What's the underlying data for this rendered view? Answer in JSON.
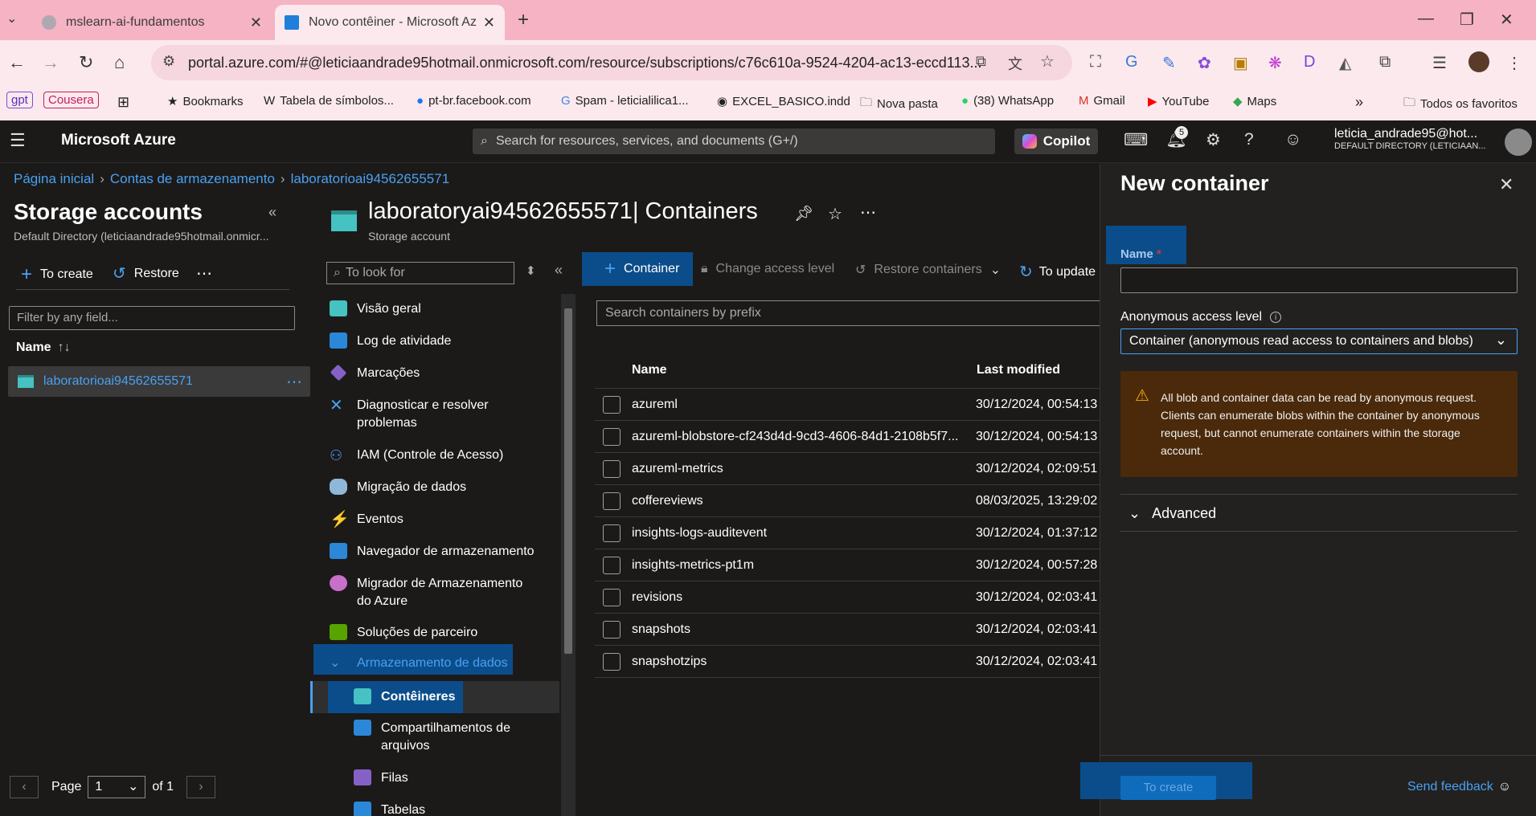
{
  "browser": {
    "tabs": [
      {
        "label": "mslearn-ai-fundamentos"
      },
      {
        "label": "Novo contêiner - Microsoft Azu"
      }
    ],
    "url": "portal.azure.com/#@leticiaandrade95hotmail.onmicrosoft.com/resource/subscriptions/c76c610a-9524-4204-ac13-eccd113...",
    "bookmarks": [
      {
        "label": "gpt"
      },
      {
        "label": "Cousera"
      },
      {
        "label": "Bookmarks"
      },
      {
        "label": "Tabela de símbolos..."
      },
      {
        "label": "pt-br.facebook.com"
      },
      {
        "label": "Spam - leticialilica1..."
      },
      {
        "label": "EXCEL_BASICO.indd"
      },
      {
        "label": "Nova pasta"
      },
      {
        "label": "(38) WhatsApp"
      },
      {
        "label": "Gmail"
      },
      {
        "label": "YouTube"
      },
      {
        "label": "Maps"
      },
      {
        "label": "Todos os favoritos"
      }
    ]
  },
  "azure": {
    "brand": "Microsoft Azure",
    "search_placeholder": "Search for resources, services, and documents (G+/)",
    "copilot": "Copilot",
    "notif_count": "5",
    "user_name": "leticia_andrade95@hot...",
    "user_dir": "DEFAULT DIRECTORY (LETICIAAN..."
  },
  "breadcrumb": [
    "Página inicial",
    "Contas de armazenamento",
    "laboratorioai94562655571"
  ],
  "left": {
    "title": "Storage accounts",
    "subtitle": "Default Directory (leticiaandrade95hotmail.onmicr...",
    "create": "To create",
    "restore": "Restore",
    "filter_placeholder": "Filter by any field...",
    "col_name": "Name",
    "account": "laboratorioai94562655571",
    "page_label": "Page",
    "page_value": "1",
    "of_label": "of 1"
  },
  "resource": {
    "title": "laboratoryai94562655571| Containers",
    "subtitle": "Storage account",
    "menu_search": "To look for",
    "menu": [
      {
        "label": "Visão geral"
      },
      {
        "label": "Log de atividade"
      },
      {
        "label": "Marcações"
      },
      {
        "label": "Diagnosticar e resolver problemas"
      },
      {
        "label": "IAM (Controle de Acesso)"
      },
      {
        "label": "Migração de dados"
      },
      {
        "label": "Eventos"
      },
      {
        "label": "Navegador de armazenamento"
      },
      {
        "label": "Migrador de Armazenamento do Azure"
      },
      {
        "label": "Soluções de parceiro"
      },
      {
        "label": "Armazenamento de dados"
      },
      {
        "label": "Contêineres"
      },
      {
        "label": "Compartilhamentos de arquivos"
      },
      {
        "label": "Filas"
      },
      {
        "label": "Tabelas"
      }
    ]
  },
  "toolbar": {
    "container": "Container",
    "change_access": "Change access level",
    "restore": "Restore containers",
    "update": "To update"
  },
  "containers": {
    "search_placeholder": "Search containers by prefix",
    "col_name": "Name",
    "col_modified": "Last modified",
    "rows": [
      {
        "name": "azureml",
        "modified": "30/12/2024, 00:54:13"
      },
      {
        "name": "azureml-blobstore-cf243d4d-9cd3-4606-84d1-2108b5f7...",
        "modified": "30/12/2024, 00:54:13"
      },
      {
        "name": "azureml-metrics",
        "modified": "30/12/2024, 02:09:51"
      },
      {
        "name": "coffereviews",
        "modified": "08/03/2025, 13:29:02"
      },
      {
        "name": "insights-logs-auditevent",
        "modified": "30/12/2024, 01:37:12"
      },
      {
        "name": "insights-metrics-pt1m",
        "modified": "30/12/2024, 00:57:28"
      },
      {
        "name": "revisions",
        "modified": "30/12/2024, 02:03:41"
      },
      {
        "name": "snapshots",
        "modified": "30/12/2024, 02:03:41"
      },
      {
        "name": "snapshotzips",
        "modified": "30/12/2024, 02:03:41"
      }
    ]
  },
  "panel": {
    "title": "New container",
    "name_label": "Name",
    "name_required": "*",
    "name_value": "",
    "access_label": "Anonymous access level",
    "access_value": "Container (anonymous read access to containers and blobs)",
    "warning": "All blob and container data can be read by anonymous request. Clients can enumerate blobs within the container by anonymous request, but cannot enumerate containers within the storage account.",
    "advanced": "Advanced",
    "create_button": "To create",
    "feedback": "Send feedback"
  },
  "colors": {
    "accent": "#0f6cbd",
    "link": "#4aa0f0",
    "highlight": "#0b4d8a",
    "warning_bg": "#4a2a0a"
  }
}
